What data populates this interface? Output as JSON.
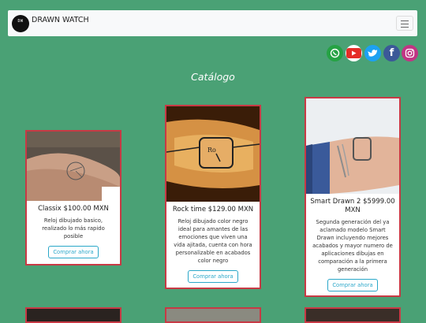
{
  "navbar": {
    "logo_text": "DW",
    "brand": "DRAWN WATCH"
  },
  "social": [
    {
      "name": "whatsapp-icon",
      "glyph": "✆",
      "color": "#25a244"
    },
    {
      "name": "youtube-icon",
      "glyph": "▶",
      "color": "#e52d27"
    },
    {
      "name": "twitter-icon",
      "glyph": "t",
      "color": "#1da1f2"
    },
    {
      "name": "facebook-icon",
      "glyph": "f",
      "color": "#3b5998"
    },
    {
      "name": "instagram-icon",
      "glyph": "◎",
      "color": "#c13584"
    }
  ],
  "page_title": "Catálogo",
  "products": [
    {
      "title": "Classix $100.00 MXN",
      "description": "Reloj dibujado basico, realizado lo más rapido posible",
      "button": "Comprar ahora"
    },
    {
      "title": "Rock time $129.00 MXN",
      "description": "Reloj dibujado color negro ideal para amantes de las emociones que viven una vida ajitada, cuenta con hora personalizable en acabados color negro",
      "button": "Comprar ahora"
    },
    {
      "title": "Smart Drawn 2 $5999.00 MXN",
      "description": "Segunda generación del ya aclamado modelo Smart Drawn incluyendo mejores acabados y mayor numero de aplicaciones dibujas en comparación a la primera generación",
      "button": "Comprar ahora"
    }
  ]
}
